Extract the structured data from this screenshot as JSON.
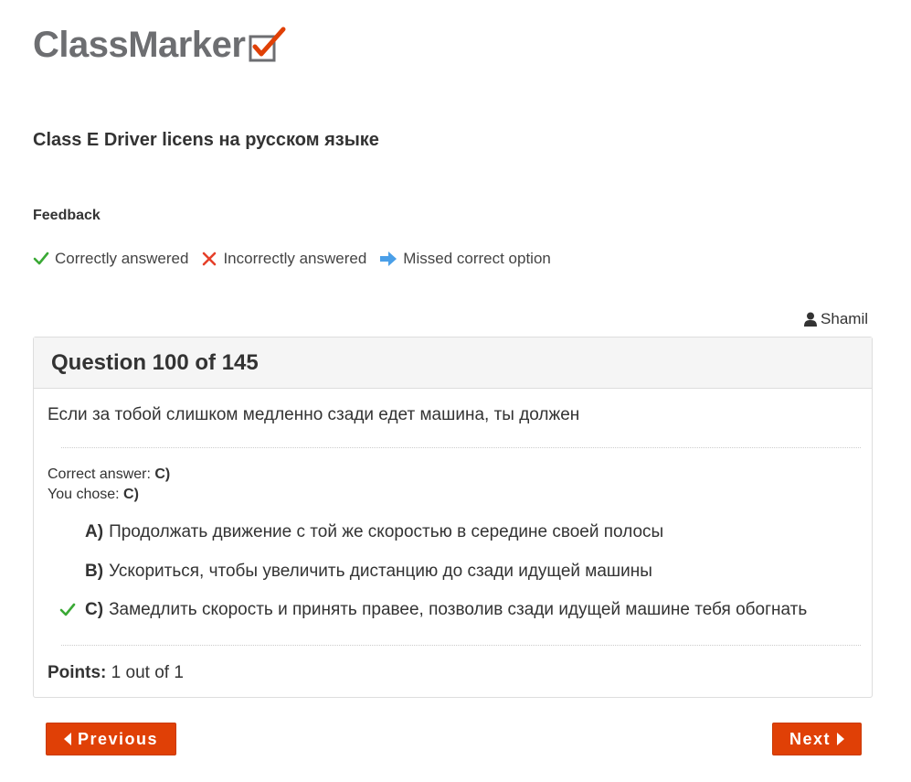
{
  "brand": {
    "name": "ClassMarker",
    "text_color": "#6d6e71",
    "check_color": "#e04006"
  },
  "test": {
    "title": "Class E Driver licens на русском языке"
  },
  "feedback": {
    "heading": "Feedback",
    "legend": [
      {
        "icon": "check-icon",
        "label": "Correctly answered",
        "color": "#3aa935"
      },
      {
        "icon": "cross-icon",
        "label": "Incorrectly answered",
        "color": "#e5402a"
      },
      {
        "icon": "arrow-right-icon",
        "label": "Missed correct option",
        "color": "#4a9fe8"
      }
    ]
  },
  "user": {
    "icon": "user-icon",
    "name": "Shamil"
  },
  "question": {
    "heading": "Question 100 of 145",
    "text": "Если за тобой слишком медленно сзади едет машина, ты должен",
    "correct_answer_label": "Correct answer:",
    "correct_answer_value": "C)",
    "you_chose_label": "You chose:",
    "you_chose_value": "C)",
    "options": [
      {
        "letter": "A)",
        "text": "Продолжать движение с той же скоростью в середине своей полосы",
        "mark": ""
      },
      {
        "letter": "B)",
        "text": "Ускориться, чтобы увеличить дистанцию до сзади идущей машины",
        "mark": ""
      },
      {
        "letter": "C)",
        "text": "Замедлить скорость и принять правее, позволив сзади идущей машине тебя обогнать",
        "mark": "check-icon"
      }
    ],
    "points_label": "Points:",
    "points_value": "1 out of 1"
  },
  "navigation": {
    "previous_label": "Previous",
    "next_label": "Next",
    "button_color": "#e04006"
  }
}
